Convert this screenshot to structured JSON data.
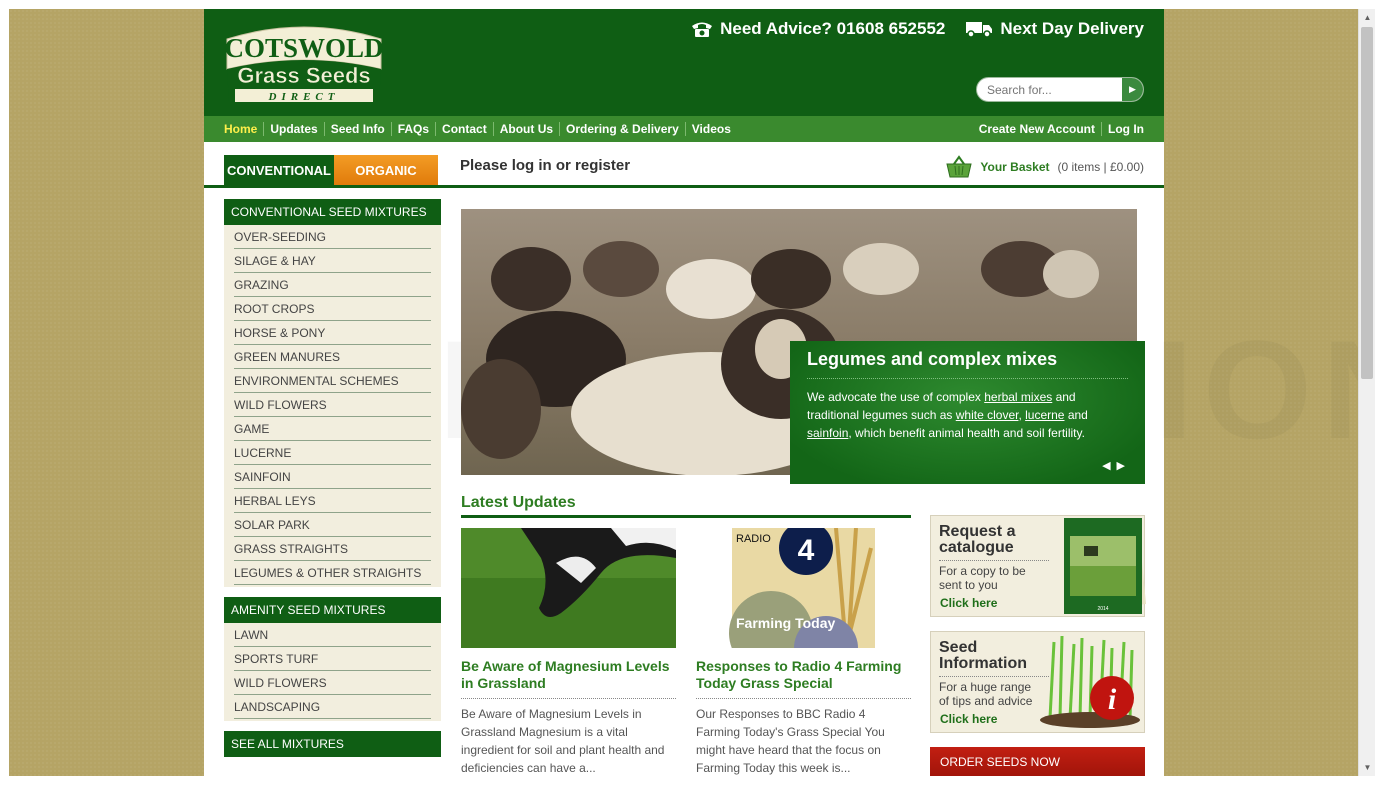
{
  "header": {
    "logo_top": "COTSWOLD",
    "logo_mid": "Grass Seeds",
    "logo_bottom": "DIRECT",
    "advice": "Need Advice? 01608 652552",
    "delivery": "Next Day Delivery",
    "search_placeholder": "Search for..."
  },
  "nav": {
    "items": [
      "Home",
      "Updates",
      "Seed Info",
      "FAQs",
      "Contact",
      "About Us",
      "Ordering & Delivery",
      "Videos"
    ],
    "right": [
      "Create New Account",
      "Log In"
    ]
  },
  "tabs": {
    "conventional": "CONVENTIONAL",
    "organic": "ORGANIC"
  },
  "login_prompt": "Please log in or register",
  "basket": {
    "label": "Your Basket",
    "value": "(0 items | £0.00)"
  },
  "sidebar": {
    "conventional_heading": "CONVENTIONAL SEED MIXTURES",
    "conventional_items": [
      "OVER-SEEDING",
      "SILAGE & HAY",
      "GRAZING",
      "ROOT CROPS",
      "HORSE & PONY",
      "GREEN MANURES",
      "ENVIRONMENTAL SCHEMES",
      "WILD FLOWERS",
      "GAME",
      "LUCERNE",
      "SAINFOIN",
      "HERBAL LEYS",
      "SOLAR PARK",
      "GRASS STRAIGHTS",
      "LEGUMES & OTHER STRAIGHTS"
    ],
    "amenity_heading": "AMENITY SEED MIXTURES",
    "amenity_items": [
      "LAWN",
      "SPORTS TURF",
      "WILD FLOWERS",
      "LANDSCAPING"
    ],
    "see_all": "SEE ALL MIXTURES"
  },
  "slider": {
    "title": "Legumes and complex mixes",
    "text_1": "We advocate the use of complex ",
    "link_1": "herbal mixes",
    "text_2": " and traditional legumes such as ",
    "link_2": "white clover",
    "text_3": ", ",
    "link_3": "lucerne",
    "text_4": " and ",
    "link_4": "sainfoin",
    "text_5": ", which benefit animal health and soil fertility."
  },
  "updates": {
    "title": "Latest Updates",
    "articles": [
      {
        "title": "Be Aware of Magnesium Levels in Grassland",
        "excerpt": "Be Aware of Magnesium Levels in Grassland  Magnesium is a vital ingredient for soil and plant health and deficiencies can have a..."
      },
      {
        "title": "Responses to Radio 4 Farming Today Grass Special",
        "excerpt": "Our Responses to BBC Radio 4 Farming Today's Grass Special  You might have heard that the focus on Farming Today this week is..."
      }
    ],
    "radio_label": "RADIO",
    "radio_number": "4",
    "radio_show": "Farming Today"
  },
  "promos": {
    "catalogue_title": "Request a catalogue",
    "catalogue_sub": "For a copy to be sent to you",
    "catalogue_cta": "Click here",
    "catalogue_year": "2014",
    "seedinfo_title": "Seed Information",
    "seedinfo_sub": "For a huge range of tips and advice",
    "seedinfo_cta": "Click here",
    "order": "ORDER SEEDS NOW"
  },
  "colors": {
    "brand_green": "#0f5e14",
    "nav_green": "#3a8a2e",
    "orange": "#e8870f",
    "link_green": "#2e7d22",
    "order_red": "#b8190e",
    "background": "#b5a465"
  }
}
